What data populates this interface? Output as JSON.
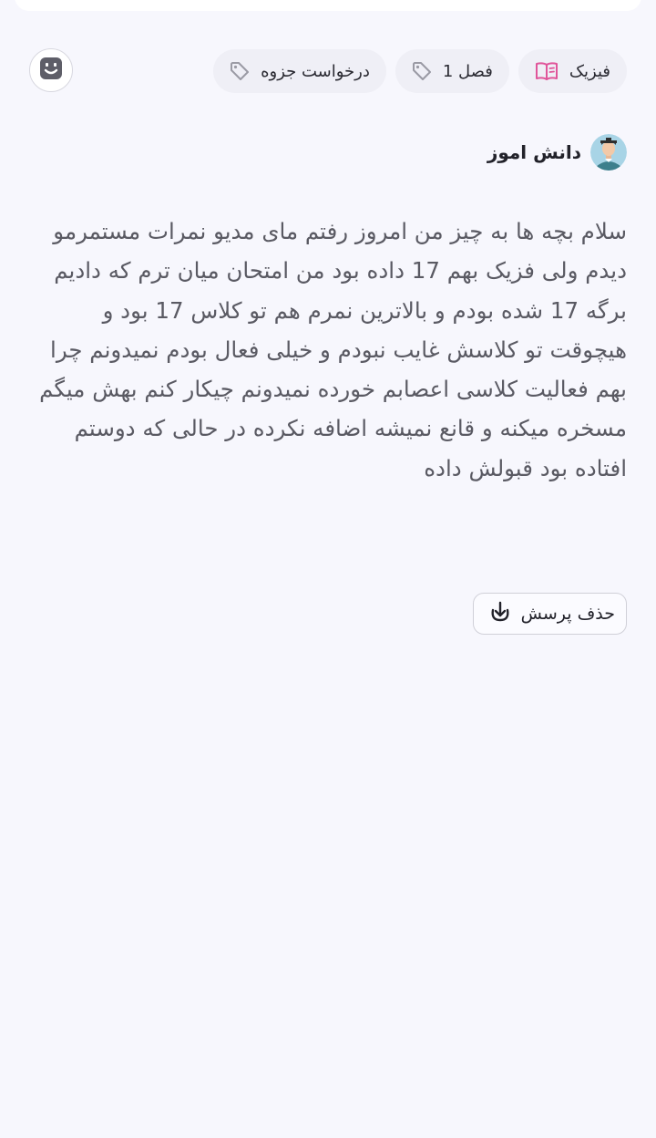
{
  "tags": [
    {
      "label": "فیزیک",
      "icon": "book-icon"
    },
    {
      "label": "فصل 1",
      "icon": "tag-icon"
    },
    {
      "label": "درخواست جزوه",
      "icon": "tag-icon"
    }
  ],
  "author": {
    "name": "دانش اموز",
    "avatar": "student-avatar"
  },
  "post": {
    "body": "سلام بچه ها به چیز من امروز رفتم مای مدیو نمرات مستمرمو دیدم ولی فزیک بهم 17 داده بود من امتحان میان ترم که دادیم برگه 17 شده بودم و بالاترین نمرم هم تو کلاس 17 بود و هیچوقت تو کلاسش غایب نبودم و خیلی فعال بودم نمیدونم چرا بهم فعالیت کلاسی اعصابم خورده نمیدونم چیکار کنم بهش میگم مسخره میکنه و قانع نمیشه اضافه نکرده در حالی که دوستم افتاده بود قبولش داده"
  },
  "actions": {
    "delete_label": "حذف پرسش"
  },
  "colors": {
    "background": "#f7f7fd",
    "tag_background": "#efeff6",
    "book_icon": "#e0559a"
  }
}
